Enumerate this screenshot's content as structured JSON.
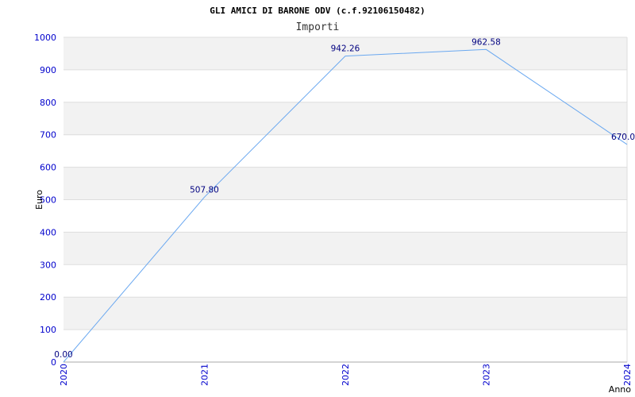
{
  "chart_data": {
    "type": "line",
    "title": "GLI AMICI DI BARONE ODV (c.f.92106150482)",
    "subtitle": "Importi",
    "xlabel": "Anno",
    "ylabel": "Euro",
    "categories": [
      "2020",
      "2021",
      "2022",
      "2023",
      "2024"
    ],
    "series": [
      {
        "values": [
          0.0,
          507.8,
          942.26,
          962.58,
          670.0
        ],
        "data_labels": [
          "0.00",
          "507.80",
          "942.26",
          "962.58",
          "670.0"
        ]
      }
    ],
    "ylim": [
      0,
      1000
    ],
    "yticks": [
      "0",
      "100",
      "200",
      "300",
      "400",
      "500",
      "600",
      "700",
      "800",
      "900",
      "1000"
    ],
    "grid": true,
    "colors": {
      "line": "#6aa8f0",
      "band": "#f2f2f2",
      "grid": "#dddddd",
      "tick_text": "#0000cc",
      "data_label": "#000080"
    }
  }
}
